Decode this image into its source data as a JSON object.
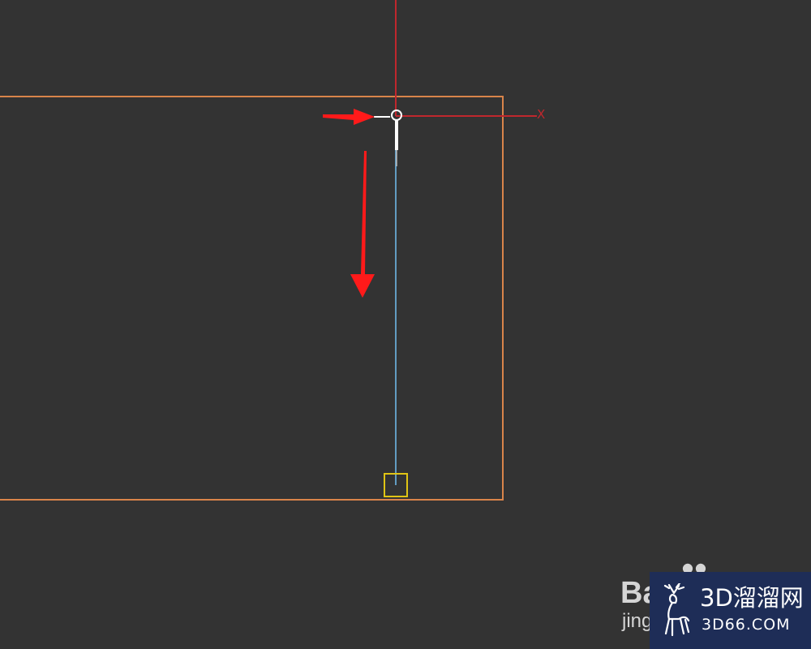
{
  "viewport": {
    "axis_x_label": "X"
  },
  "colors": {
    "background": "#333333",
    "rectangle_outline": "#d9844a",
    "axis_red": "#c0272d",
    "drawn_line": "#6fb7e6",
    "snap_marker": "#e0c414",
    "arrow": "#ff1a1a",
    "cursor": "#ffffff"
  },
  "watermarks": {
    "baidu_text": "Ba",
    "baidu_sub": "jing",
    "site_name": "3D溜溜网",
    "site_url": "3D66.COM"
  }
}
